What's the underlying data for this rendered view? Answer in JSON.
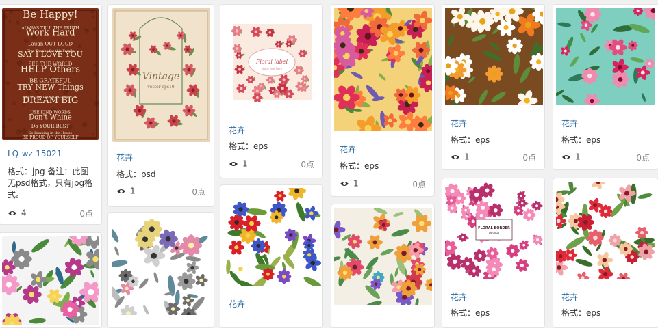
{
  "cards": [
    {
      "title": "LQ-wz-15021",
      "format": "格式：jpg 备注：此图无psd格式，只有jpg格式。",
      "views": "4",
      "points": "0点",
      "image": {
        "kind": "poster",
        "texts": [
          "Be Happy!",
          "ALWAYS TELL THE TRUTH",
          "Work Hard",
          "Laugh OUT LOUD",
          "Give Thanks for this Family",
          "SAY I LOVE YOU",
          "SEE THE WORLD",
          "HELP Others",
          "BE GRATEFUL",
          "TRY NEW Things",
          "SAY PLEASE AND THANK YOU",
          "DREAM BIG",
          "USE KIND WORDS",
          "Don't Whine",
          "Do YOUR BEST",
          "Go Running in the House",
          "BE PROUD OF YOURSELF",
          "REMEMBER YOU ARE LOVED!"
        ]
      }
    },
    {
      "category": "花卉",
      "format": "格式：psd",
      "views": "1",
      "points": "0点",
      "image": {
        "kind": "vintage",
        "texts": [
          "Vintage",
          "vector eps10"
        ]
      }
    },
    {
      "category": "花卉",
      "format": "格式：eps",
      "views": "1",
      "points": "0点",
      "image": {
        "kind": "label",
        "texts": [
          "Floral label",
          "place text here"
        ]
      }
    },
    {
      "category": "花卉",
      "format": "格式：eps",
      "views": "1",
      "points": "0点",
      "image": {
        "kind": "bold"
      }
    },
    {
      "category": "花卉",
      "format": "格式：eps",
      "views": "1",
      "points": "0点",
      "image": {
        "kind": "daisy"
      }
    },
    {
      "category": "花卉",
      "format": "格式：eps",
      "views": "1",
      "points": "0点",
      "image": {
        "kind": "tropical"
      }
    },
    {
      "image": {
        "kind": "lily"
      }
    },
    {
      "image": {
        "kind": "sketch"
      }
    },
    {
      "category": "花卉",
      "image": {
        "kind": "wild"
      }
    },
    {
      "image": {
        "kind": "watercolor"
      }
    },
    {
      "category": "花卉",
      "format": "格式：eps",
      "image": {
        "kind": "border",
        "texts": [
          "FLORAL BORDER",
          "DESIGN"
        ]
      }
    },
    {
      "category": "花卉",
      "format": "格式：eps",
      "image": {
        "kind": "roses"
      }
    }
  ]
}
